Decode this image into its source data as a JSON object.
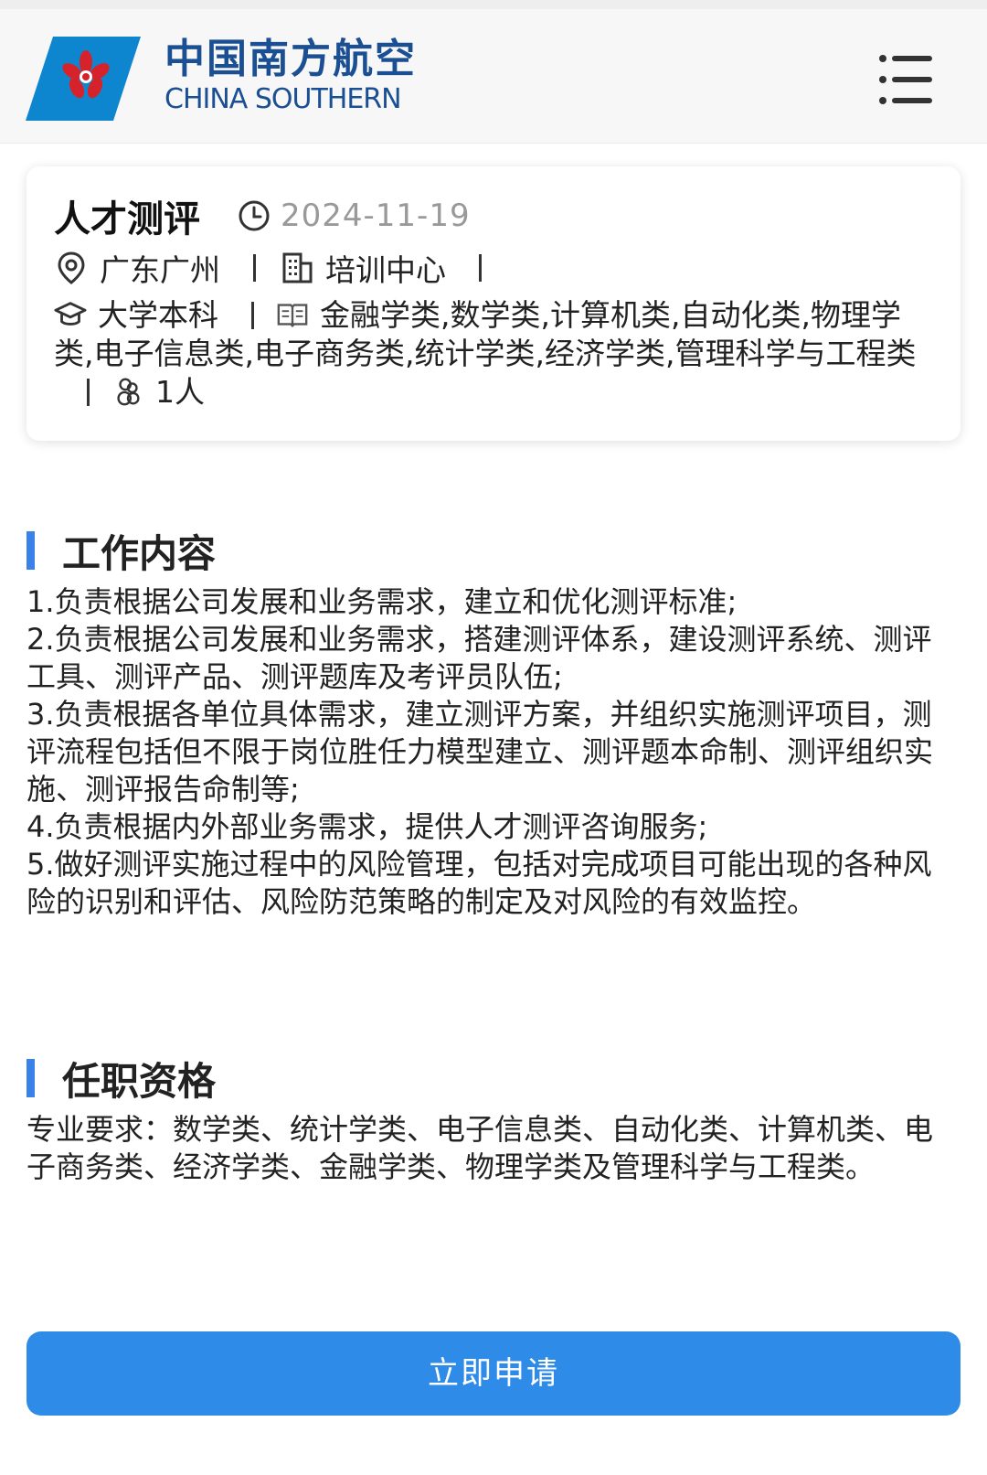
{
  "header": {
    "logo_cn": "中国南方航空",
    "logo_en": "CHINA SOUTHERN",
    "menu_icon": "menu-icon"
  },
  "job": {
    "title": "人才测评",
    "date": "2024-11-19",
    "location": "广东广州",
    "department": "培训中心",
    "education": "大学本科",
    "majors": "金融学类,数学类,计算机类,自动化类,物理学类,电子信息类,电子商务类,统计学类,经济学类,管理科学与工程类",
    "headcount": "1人"
  },
  "work_content": {
    "title": "工作内容",
    "body": "1.负责根据公司发展和业务需求，建立和优化测评标准;\n2.负责根据公司发展和业务需求，搭建测评体系，建设测评系统、测评工具、测评产品、测评题库及考评员队伍;\n3.负责根据各单位具体需求，建立测评方案，并组织实施测评项目，测评流程包括但不限于岗位胜任力模型建立、测评题本命制、测评组织实施、测评报告命制等;\n4.负责根据内外部业务需求，提供人才测评咨询服务;\n5.做好测评实施过程中的风险管理，包括对完成项目可能出现的各种风险的识别和评估、风险防范策略的制定及对风险的有效监控。"
  },
  "qualifications": {
    "title": "任职资格",
    "body": "专业要求：数学类、统计学类、电子信息类、自动化类、计算机类、电子商务类、经济学类、金融学类、物理学类及管理科学与工程类。"
  },
  "apply": {
    "label": "立即申请"
  },
  "colors": {
    "accent": "#2e8be8",
    "section_bar": "#3b82e8",
    "brand_blue": "#1b4f93",
    "logo_red": "#d6232b"
  }
}
